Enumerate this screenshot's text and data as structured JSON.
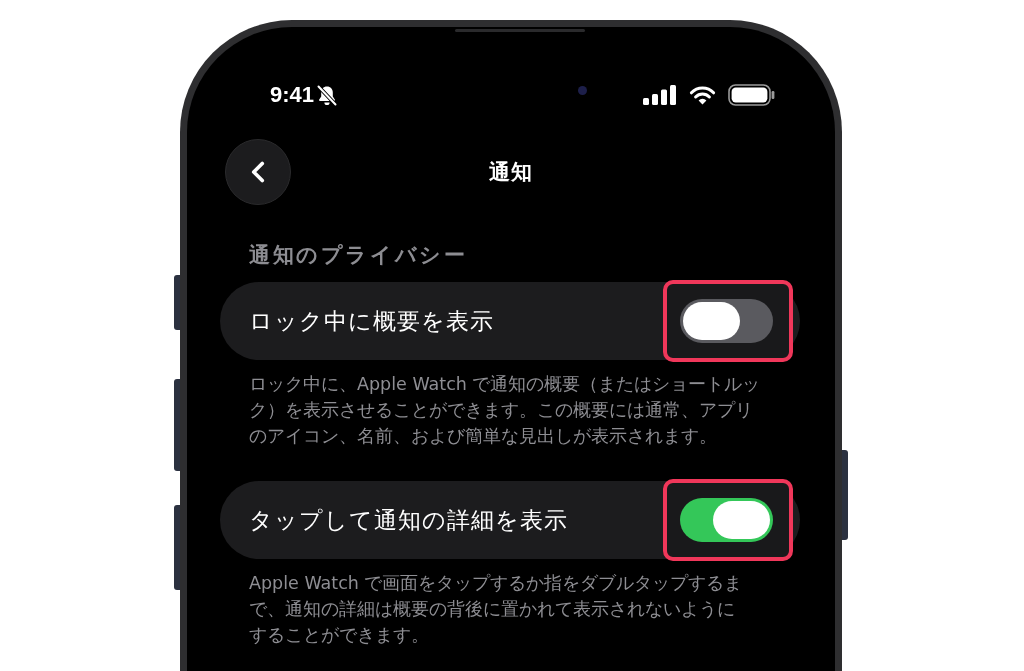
{
  "status_bar": {
    "time": "9:41"
  },
  "nav_bar": {
    "title": "通知"
  },
  "section": {
    "header": "通知のプライバシー",
    "settings": [
      {
        "label": "ロック中に概要を表示",
        "on": false,
        "highlighted": true,
        "description": "ロック中に、Apple Watch で通知の概要（またはショートルック）を表示させることができます。この概要には通常、アプリのアイコン、名前、および簡単な見出しが表示されます。"
      },
      {
        "label": "タップして通知の詳細を表示",
        "on": true,
        "highlighted": true,
        "description": "Apple Watch で画面をタップするか指をダブルタップするまで、通知の詳細は概要の背後に置かれて表示されないようにすることができます。"
      }
    ]
  }
}
